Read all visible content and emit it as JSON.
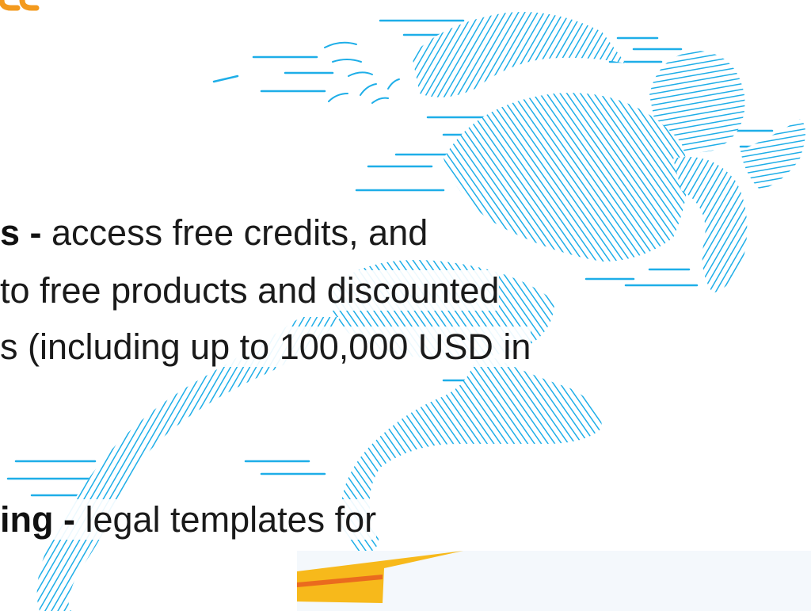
{
  "content": {
    "line_1": {
      "bold": "s -",
      "text": " access free credits, and"
    },
    "line_2": {
      "text": "to free products and discounted"
    },
    "line_3": {
      "text": "s (including up to 100,000 USD in"
    },
    "line_4": {
      "bold": "ing -",
      "text": " legal templates for"
    }
  },
  "colors": {
    "runner_stroke": "#1eaee8",
    "brand_orange": "#f39a1e",
    "accent_yellow": "#f7b91b",
    "accent_orange": "#ea6b1e",
    "footer_panel": "#f4f8fc",
    "text": "#1a1a1a"
  },
  "icons": {
    "logo": "brand-logo-fragment",
    "illustration": "sprinting-runner-line-art"
  }
}
